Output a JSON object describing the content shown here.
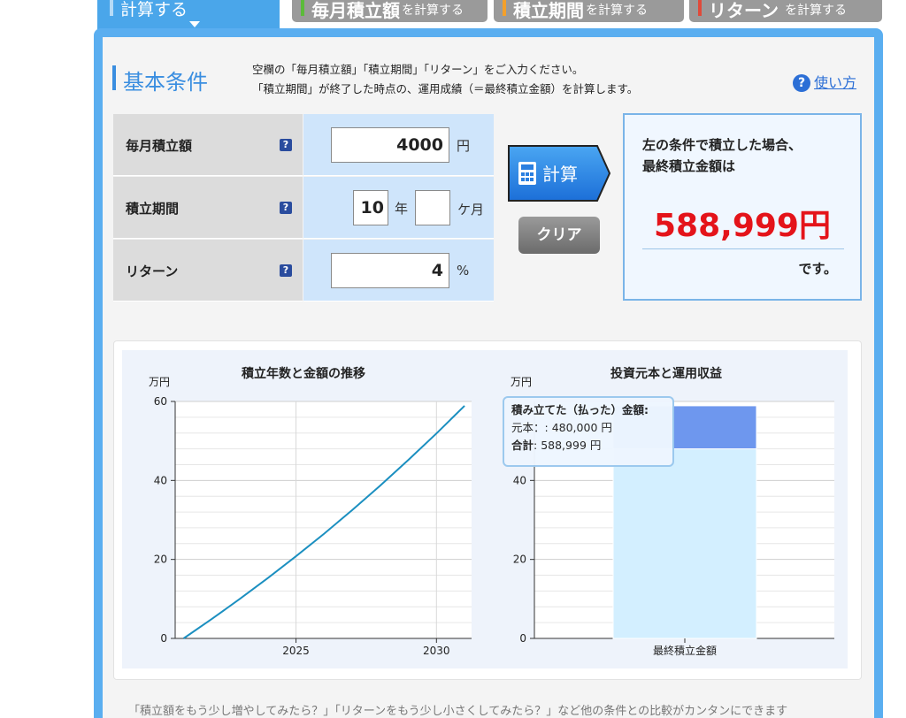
{
  "tabs": [
    {
      "main": "計算する",
      "sub": "",
      "active": true
    },
    {
      "main": "毎月積立額",
      "sub": "を計算する",
      "color": "#5bbb3a"
    },
    {
      "main": "積立期間",
      "sub": "を計算する",
      "color": "#f3a02a"
    },
    {
      "main": "リターン",
      "sub": "を計算する",
      "color": "#e04a3a"
    }
  ],
  "header": {
    "title": "基本条件",
    "desc_line1": "空欄の「毎月積立額」「積立期間」「リターン」をご入力ください。",
    "desc_line2": "「積立期間」が終了した時点の、運用成績（＝最終積立金額）を計算します。",
    "howto": "使い方"
  },
  "form": {
    "monthly": {
      "label": "毎月積立額",
      "value": "4000",
      "unit": "円"
    },
    "period": {
      "label": "積立期間",
      "years": "10",
      "year_unit": "年",
      "months": "",
      "month_unit": "ケ月"
    },
    "ret": {
      "label": "リターン",
      "value": "4",
      "unit": "%"
    },
    "help_glyph": "?"
  },
  "buttons": {
    "calc": "計算",
    "clear": "クリア"
  },
  "result": {
    "line1": "左の条件で積立した場合、",
    "line2": "最終積立金額は",
    "amount": "588,999円",
    "suffix": "です。"
  },
  "chart_data": [
    {
      "type": "line",
      "title": "積立年数と金額の推移",
      "yunit": "万円",
      "x": [
        2021,
        2022,
        2023,
        2024,
        2025,
        2026,
        2027,
        2028,
        2029,
        2030,
        2031
      ],
      "series": [
        {
          "values": [
            0,
            4.9,
            10.0,
            15.3,
            20.8,
            26.5,
            32.5,
            38.7,
            45.2,
            51.9,
            58.9
          ]
        }
      ],
      "xticks": [
        "2025",
        "2030"
      ],
      "yticks": [
        0,
        20,
        40,
        60
      ],
      "ylim": [
        0,
        60
      ],
      "color": "#1b8fc0"
    },
    {
      "type": "bar",
      "title": "投資元本と運用収益",
      "yunit": "万円",
      "categories": [
        "最終積立金額"
      ],
      "series": [
        {
          "values": [
            48.0
          ],
          "color": "#d3efff"
        },
        {
          "values": [
            10.8999
          ],
          "color": "#6e97ee"
        }
      ],
      "yticks": [
        0,
        20,
        40
      ],
      "ylim": [
        0,
        60
      ]
    }
  ],
  "tooltip": {
    "title": "積み立てた（払った）金額:",
    "principal_label": "元本：",
    "principal_value": ": 480,000 円",
    "total_label": "合計",
    "total_value": ": 588,999 円"
  },
  "bottom_note": "「積立額をもう少し増やしてみたら？」「リターンをもう少し小さくしてみたら？」など他の条件との比較がカンタンにできます"
}
